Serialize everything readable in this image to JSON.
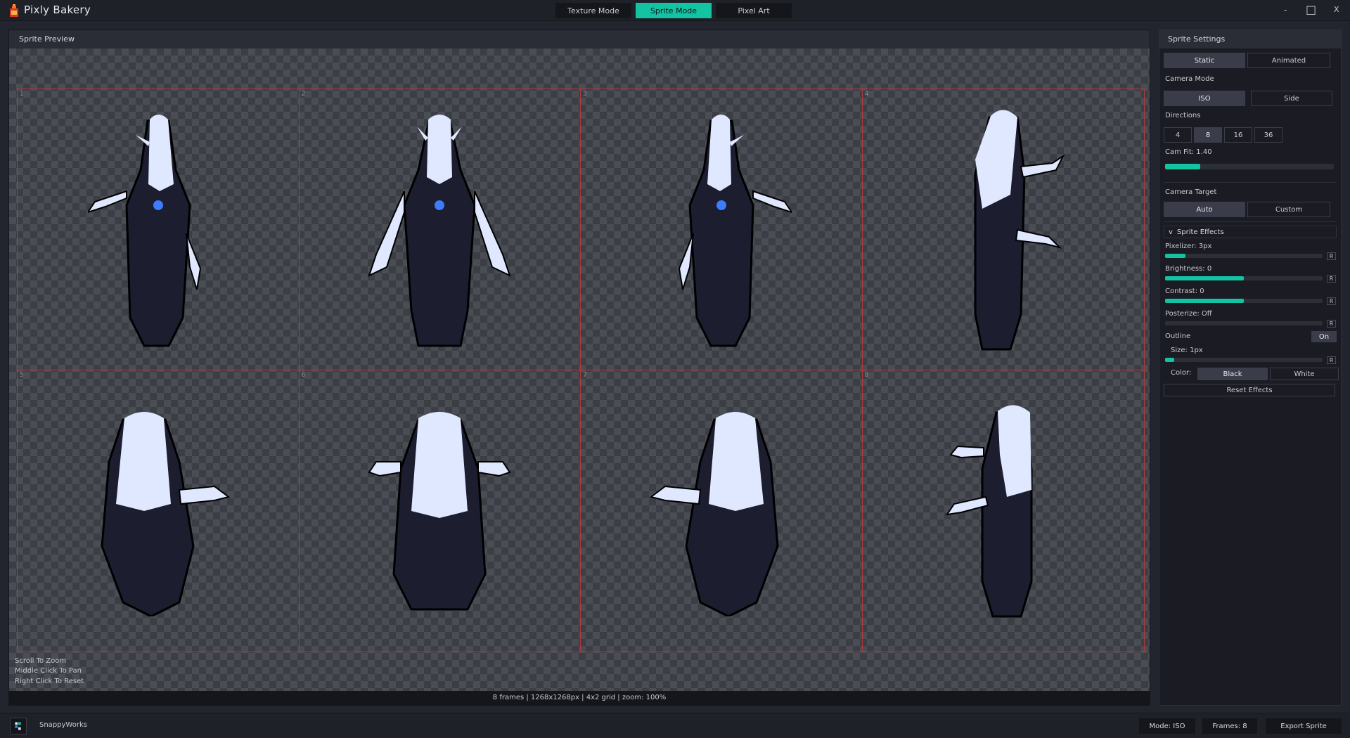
{
  "app": {
    "title": "Pixly Bakery"
  },
  "mode_tabs": [
    {
      "label": "Texture Mode",
      "active": false
    },
    {
      "label": "Sprite Mode",
      "active": true
    },
    {
      "label": "Pixel Art",
      "active": false
    }
  ],
  "window": {
    "minimize": "-",
    "maximize": "□",
    "close": "X"
  },
  "preview": {
    "title": "Sprite Preview",
    "frames": [
      "1",
      "2",
      "3",
      "4",
      "5",
      "6",
      "7",
      "8"
    ],
    "hints": [
      "Scroll To Zoom",
      "Middle Click To Pan",
      "Right Click To Reset"
    ],
    "status": "8 frames  |  1268x1268px  |  4x2 grid  |  zoom: 100%"
  },
  "settings": {
    "title": "Sprite Settings",
    "type_tabs": [
      "Static",
      "Animated"
    ],
    "camera_mode": {
      "label": "Camera Mode",
      "options": [
        "ISO",
        "Side"
      ]
    },
    "directions": {
      "label": "Directions",
      "options": [
        "4",
        "8",
        "16",
        "36"
      ]
    },
    "cam_fit": {
      "label": "Cam Fit: 1.40",
      "level": 0.21
    },
    "camera_target": {
      "label": "Camera Target",
      "options": [
        "Auto",
        "Custom"
      ]
    },
    "effects": {
      "toggle": "v",
      "label": "Sprite Effects",
      "pixelizer": {
        "label": "Pixelizer: 3px",
        "level": 0.13
      },
      "brightness": {
        "label": "Brightness: 0",
        "level": 0.5
      },
      "contrast": {
        "label": "Contrast: 0",
        "level": 0.5
      },
      "posterize": {
        "label": "Posterize: Off",
        "level": 0
      },
      "reset_short": "R",
      "outline": {
        "label": "Outline",
        "toggle": "On"
      },
      "size": {
        "label": "Size: 1px",
        "level": 0.06
      },
      "color": {
        "label": "Color:",
        "options": [
          "Black",
          "White"
        ]
      },
      "reset_label": "Reset Effects"
    }
  },
  "footer": {
    "brand": "SnappyWorks",
    "mode": "Mode: ISO",
    "frames": "Frames: 8",
    "export": "Export Sprite"
  },
  "colors": {
    "accent": "#13c4a3",
    "grid_line": "#b43838",
    "sprite_dark": "#1c1d2e",
    "sprite_hair": "#dfe8ff",
    "sprite_glow": "#3d7bff"
  }
}
